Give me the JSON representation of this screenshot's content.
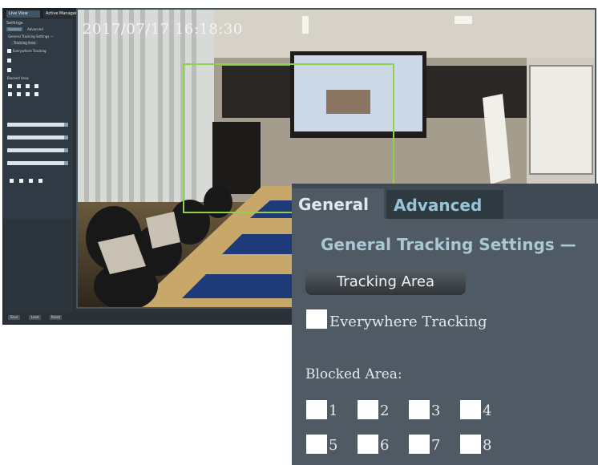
{
  "app": {
    "tabs": [
      {
        "label": "Live View"
      },
      {
        "label": "Active Manager"
      }
    ],
    "close_glyph": "✕",
    "sidebar": {
      "title": "Settings",
      "tabs": [
        "General",
        "Advanced"
      ],
      "section_title": "General Tracking Settings —",
      "tracking_area": "Tracking Area",
      "everywhere_tracking": "Everywhere Tracking",
      "blocked_label": "Blocked Area:",
      "blocked_numbers": [
        "1",
        "2",
        "3",
        "4",
        "5",
        "6",
        "7",
        "8"
      ]
    },
    "bottom_buttons": [
      "Save",
      "Load",
      "Reset"
    ]
  },
  "video": {
    "timestamp": "2017/07/17 16:18:30"
  },
  "panel": {
    "tabs": {
      "general": "General",
      "advanced": "Advanced"
    },
    "section_title": "General Tracking Settings —",
    "tracking_area_button": "Tracking Area",
    "everywhere_label": "Everywhere Tracking",
    "blocked_label": "Blocked Area:",
    "blocked_areas": [
      "1",
      "2",
      "3",
      "4",
      "5",
      "6",
      "7",
      "8"
    ]
  },
  "colors": {
    "panel_bg": "#4f5a64",
    "tab_active_text": "#dfe8ee",
    "tab_inactive_text": "#98c4d8",
    "section_title": "#a9c8d4",
    "tracking_box": "#8fd24a"
  }
}
